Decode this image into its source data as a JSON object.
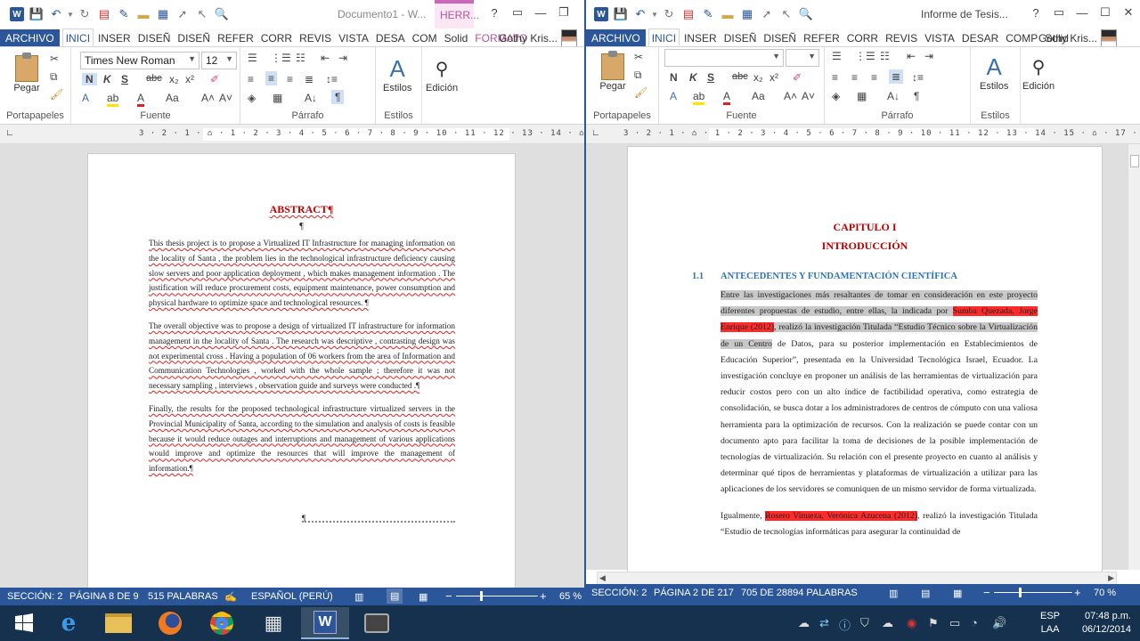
{
  "left_window": {
    "title": "Documento1 - W...",
    "context_tab": "HERR...",
    "tabs": [
      "ARCHIVO",
      "INICI",
      "INSER",
      "DISEÑ",
      "DISEÑ",
      "REFER",
      "CORR",
      "REVIS",
      "VISTA",
      "DESA",
      "COM",
      "Solid",
      "FORMATO"
    ],
    "user": "Gothy Kris...",
    "ribbon": {
      "font_name": "Times New Roman",
      "font_size": "12",
      "paste": "Pegar",
      "styles": "Estilos",
      "editing": "Edición",
      "groups": [
        "Portapapeles",
        "Fuente",
        "Párrafo",
        "Estilos"
      ]
    },
    "ruler": "3 · 2 · 1 · ⌂ · 1 · 2 · 3 · 4 · 5 · 6 · 7 · 8 · 9 · 10 · 11 · 12 · 13 · 14 · ⌂ · 16 · 17",
    "doc": {
      "heading": "ABSTRACT¶",
      "pilcrow": "¶",
      "p1": "This thesis project is to propose a Virtualized IT Infrastructure for managing information on the locality of Santa , the problem lies in the technological infrastructure deficiency causing slow servers and poor application deployment , which makes management information . The justification will reduce procurement costs, equipment maintenance, power consumption and physical hardware to optimize space and technological resources. ¶",
      "p2": "The overall objective was to propose a design of virtualized IT infrastructure for information management in the locality of Santa . The research was descriptive , contrasting design was not experimental cross . Having a population of 06 workers from the area of Information and Communication Technologies , worked with the whole sample ; therefore it was not necessary sampling , interviews , observation guide and surveys were conducted .¶",
      "p3": "Finally, the results for the proposed technological infrastructure virtualized servers in the Provincial Municipality of Santa, according to the simulation and analysis of costs is feasible because it would reduce outages and interruptions and management of various applications would improve and optimize the resources that will improve the management of information.¶",
      "section_break": "¶"
    },
    "status": {
      "section": "SECCIÓN: 2",
      "page": "PÁGINA 8 DE 9",
      "words": "515 PALABRAS",
      "lang": "ESPAÑOL (PERÚ)",
      "zoom": "65 %",
      "zoom_value": 65
    }
  },
  "right_window": {
    "title": "Informe de Tesis...",
    "tabs": [
      "ARCHIVO",
      "INICI",
      "INSER",
      "DISEÑ",
      "DISEÑ",
      "REFER",
      "CORR",
      "REVIS",
      "VISTA",
      "DESAR",
      "COMP",
      "Solid"
    ],
    "user": "Gothy Kris...",
    "ribbon": {
      "paste": "Pegar",
      "styles": "Estilos",
      "editing": "Edición",
      "groups": [
        "Portapapeles",
        "Fuente",
        "Párrafo",
        "Estilos"
      ]
    },
    "ruler": "3 · 2 · 1 · ⌂ · 1 · 2 · 3 · 4 · 5 · 6 · 7 · 8 · 9 · 10 · 11 · 12 · 13 · 14 · 15 · ⌂ · 17 · 18",
    "doc": {
      "chapter": "CAPITULO I",
      "chapter_title": "INTRODUCCIÓN",
      "section_num": "1.1",
      "section_title": "ANTECEDENTES Y FUNDAMENTACIÓN CIENTÍFICA",
      "p1_a": "Entre las investigaciones más resaltantes de tomar en consideración en este proyecto diferentes propuestas de estudio, entre ellas, la indicada por ",
      "p1_cite": "Sumba Quezada, Jorge Enrique (2012)",
      "p1_b": ", realizó la investigación Titulada “Estudio Técnico sobre la Virtualización de un Centro",
      "p1_c": " de Datos, para su posterior implementación en Establecimientos de Educación Superior”, presentada en la Universidad Tecnológica Israel, Ecuador. La investigación concluye en proponer un análisis de las herramientas de virtualización para reducir costos pero con un alto índice de factibilidad operativa, como estrategia de consolidación, se busca dotar a los administradores de centros de cómputo con una valiosa herramienta para la optimización de recursos. Con la realización se puede contar con un documento apto para facilitar la toma de decisiones de la posible implementación de tecnologías de virtualización. Su relación con el presente proyecto en cuanto al análisis y determinar qué tipos de herramientas y plataformas de virtualización a utilizar para las aplicaciones de los servidores se comuniquen de un mismo servidor de forma virtualizada.",
      "p2_a": "Igualmente, ",
      "p2_cite": "Rosero Vinueza, Verónica Azucena (2012)",
      "p2_b": ", realizó la investigación Titulada “Estudio de tecnologías informáticas para asegurar la continuidad de"
    },
    "status": {
      "section": "SECCIÓN: 2",
      "page": "PÁGINA 2 DE 217",
      "words": "705 DE 28894 PALABRAS",
      "zoom": "70 %",
      "zoom_value": 70
    }
  },
  "taskbar": {
    "lang": "ESP",
    "layout": "LAA",
    "time": "07:48 p.m.",
    "date": "06/12/2014"
  }
}
